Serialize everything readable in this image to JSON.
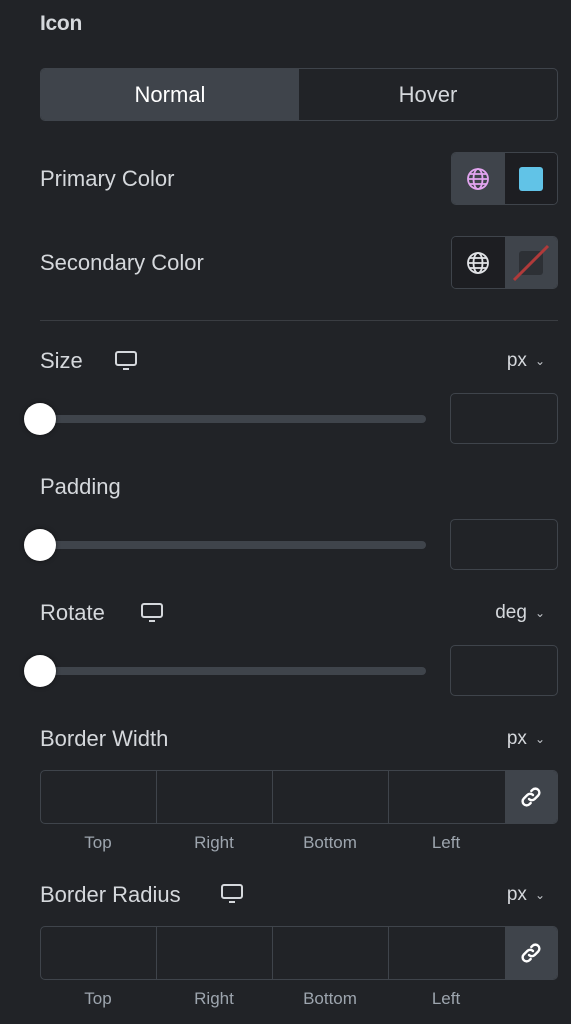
{
  "section": {
    "title": "Icon"
  },
  "tabs": [
    {
      "label": "Normal",
      "active": true
    },
    {
      "label": "Hover",
      "active": false
    }
  ],
  "primary_color": {
    "label": "Primary Color",
    "global_icon": "globe-icon",
    "global_active": true,
    "swatch_color": "#61c3e7",
    "global_icon_color": "#e3a5f0"
  },
  "secondary_color": {
    "label": "Secondary Color",
    "global_icon": "globe-icon",
    "global_active": false,
    "swatch": "none",
    "global_icon_color": "#e1e3e6"
  },
  "size": {
    "label": "Size",
    "responsive_icon": "desktop-icon",
    "unit": "px",
    "value": "",
    "slider_fraction": 0
  },
  "padding": {
    "label": "Padding",
    "value": "",
    "slider_fraction": 0
  },
  "rotate": {
    "label": "Rotate",
    "responsive_icon": "desktop-icon",
    "unit": "deg",
    "value": "",
    "slider_fraction": 0
  },
  "border_width": {
    "label": "Border Width",
    "unit": "px",
    "fields": [
      {
        "label": "Top",
        "value": ""
      },
      {
        "label": "Right",
        "value": ""
      },
      {
        "label": "Bottom",
        "value": ""
      },
      {
        "label": "Left",
        "value": ""
      }
    ],
    "link_icon": "link-icon"
  },
  "border_radius": {
    "label": "Border Radius",
    "responsive_icon": "desktop-icon",
    "unit": "px",
    "fields": [
      {
        "label": "Top",
        "value": ""
      },
      {
        "label": "Right",
        "value": ""
      },
      {
        "label": "Bottom",
        "value": ""
      },
      {
        "label": "Left",
        "value": ""
      }
    ],
    "link_icon": "link-icon"
  },
  "chevron_glyph": "⌄"
}
